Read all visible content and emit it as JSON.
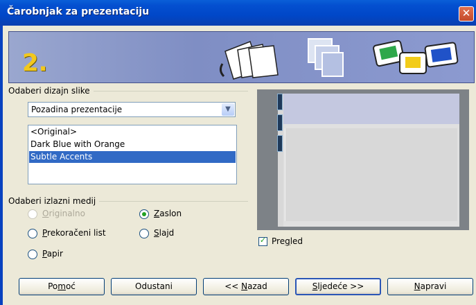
{
  "window": {
    "title": "Čarobnjak za prezentaciju",
    "close_icon": "close-icon"
  },
  "banner": {
    "step": "2.",
    "colors": {
      "background": "#8592c8",
      "step": "#f2c81c"
    }
  },
  "design_group": {
    "label": "Odaberi dizajn slike",
    "category": {
      "value": "Pozadina prezentacije"
    },
    "items": [
      {
        "label": "<Original>",
        "selected": false
      },
      {
        "label": "Dark Blue with Orange",
        "selected": false
      },
      {
        "label": "Subtle Accents",
        "selected": true
      }
    ]
  },
  "output_group": {
    "label": "Odaberi izlazni medij",
    "options": {
      "original": {
        "pre": "",
        "acc": "O",
        "post": "riginalno",
        "checked": false,
        "enabled": false
      },
      "screen": {
        "pre": "",
        "acc": "Z",
        "post": "aslon",
        "checked": true,
        "enabled": true
      },
      "overhead": {
        "pre": "",
        "acc": "P",
        "post": "rekoračeni list",
        "checked": false,
        "enabled": true
      },
      "slide": {
        "pre": "",
        "acc": "S",
        "post": "lajd",
        "checked": false,
        "enabled": true
      },
      "paper": {
        "pre": "",
        "acc": "P",
        "post": "apir",
        "checked": false,
        "enabled": true
      }
    }
  },
  "preview": {
    "pre": "Pre",
    "acc": "g",
    "post": "led",
    "checked": true
  },
  "buttons": {
    "help": {
      "pre": "Po",
      "acc": "m",
      "post": "oć"
    },
    "cancel": {
      "label": "Odustani"
    },
    "back": {
      "pre": "<< ",
      "acc": "N",
      "post": "azad"
    },
    "next": {
      "pre": "",
      "acc": "S",
      "post": "ljedeće >>"
    },
    "create": {
      "pre": "",
      "acc": "N",
      "post": "apravi"
    }
  }
}
